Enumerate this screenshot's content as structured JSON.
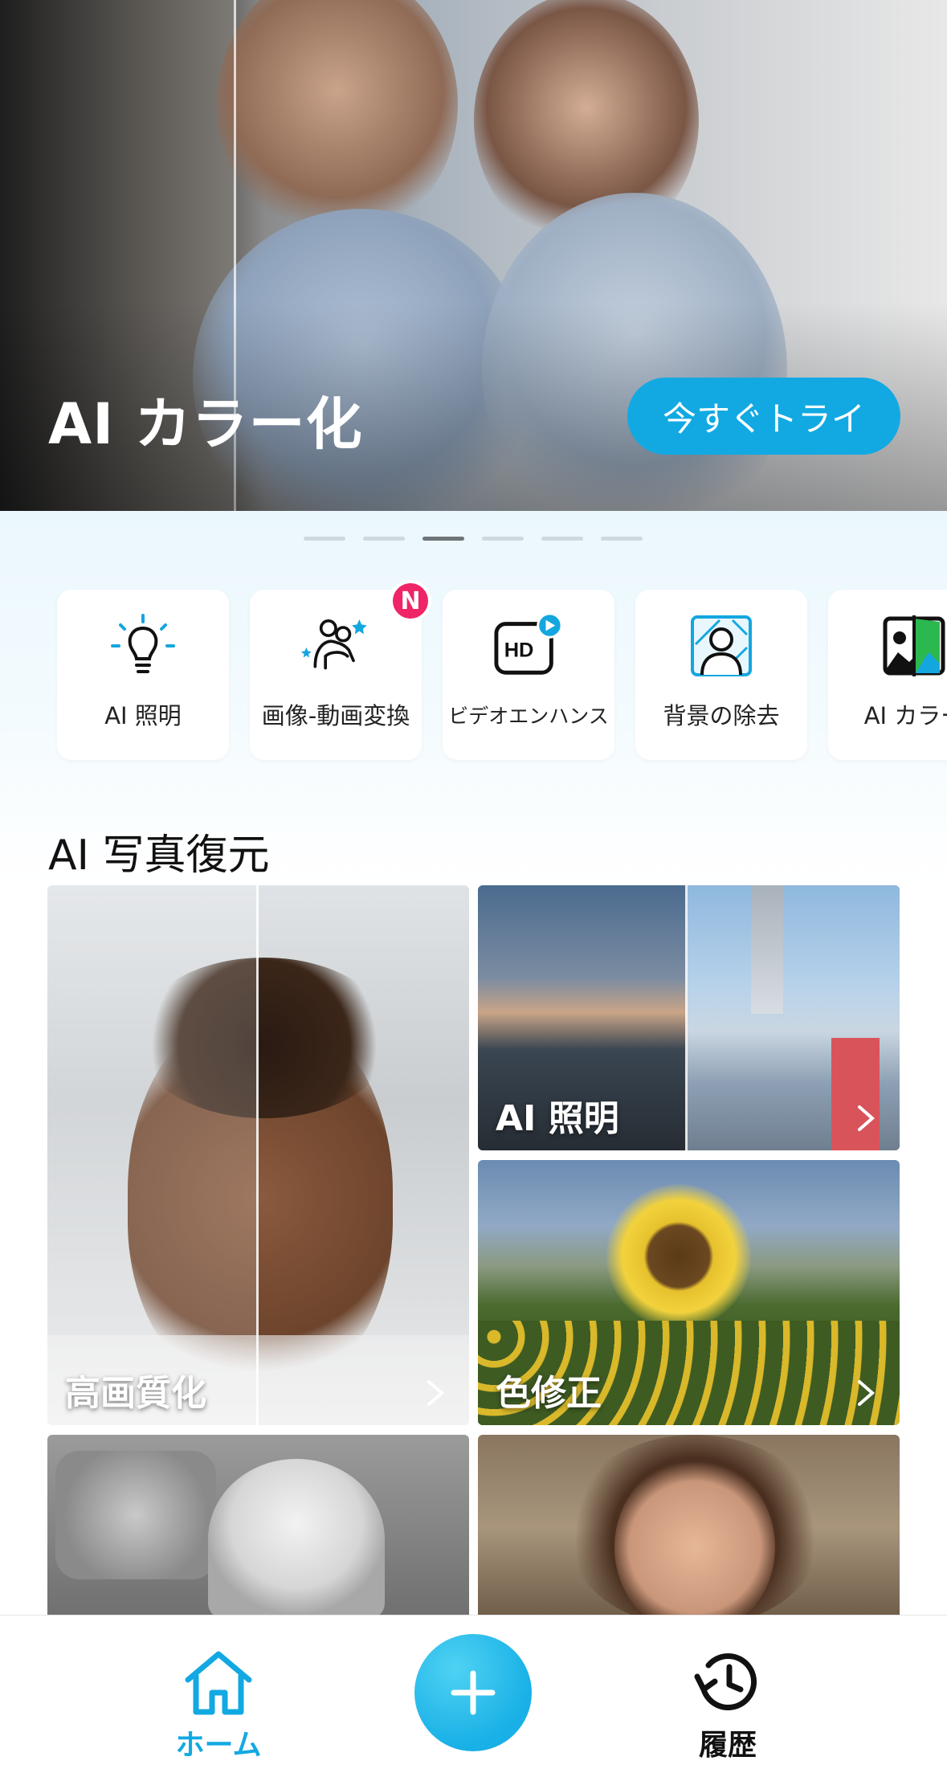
{
  "hero": {
    "title": "AI カラー化",
    "cta_label": "今すぐトライ"
  },
  "pager": {
    "count": 6,
    "active_index": 2
  },
  "tools": [
    {
      "label": "AI 照明",
      "icon": "lightbulb-icon"
    },
    {
      "label": "画像-動画変換",
      "icon": "people-sparkle-icon",
      "badge": "N"
    },
    {
      "label": "ビデオエンハンス",
      "icon": "hd-play-icon"
    },
    {
      "label": "背景の除去",
      "icon": "person-background-icon"
    },
    {
      "label": "AI カラー",
      "icon": "colorize-icon"
    }
  ],
  "section": {
    "title": "AI 写真復元"
  },
  "cards": {
    "enhance": {
      "label": "高画質化"
    },
    "lighting": {
      "label": "AI 照明"
    },
    "color_fix": {
      "label": "色修正"
    }
  },
  "nav": {
    "home_label": "ホーム",
    "history_label": "履歴",
    "active_color": "#12a9e2",
    "inactive_color": "#111111"
  },
  "colors": {
    "accent": "#12a9e2",
    "badge": "#ee2566"
  }
}
